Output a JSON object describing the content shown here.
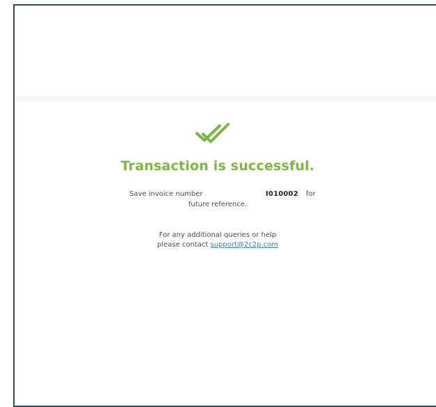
{
  "colors": {
    "accent_green": "#7ab83f",
    "frame_border": "#2e4a57",
    "link": "#3f79c8"
  },
  "icons": {
    "success": "double-check-icon"
  },
  "status": {
    "title": "Transaction is successful."
  },
  "invoice": {
    "save_prefix": "Save invoice number",
    "number": "I010002",
    "save_suffix": "for",
    "future_reference": "future reference."
  },
  "contact": {
    "line1": "For any additional queries or help",
    "line2_prefix": "please contact",
    "email": "support@2c2p.com"
  }
}
